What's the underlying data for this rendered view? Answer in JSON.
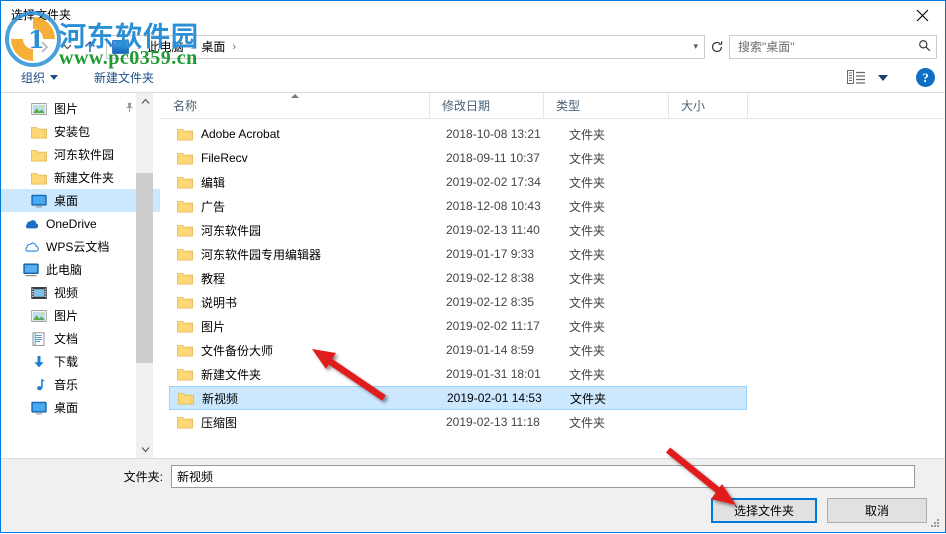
{
  "window": {
    "title": "选择文件夹",
    "close_label": "✕"
  },
  "nav": {
    "back_icon": "back-arrow-icon",
    "forward_icon": "forward-arrow-icon",
    "recent_icon": "chevron-down-icon",
    "up_icon": "up-arrow-icon",
    "refresh_icon": "refresh-icon",
    "breadcrumb": [
      "此电脑",
      "桌面"
    ],
    "separator": "›"
  },
  "search": {
    "placeholder": "搜索\"桌面\"",
    "icon": "search-icon"
  },
  "toolbar": {
    "organize_label": "组织",
    "new_folder_label": "新建文件夹",
    "view_icon": "view-layout-icon",
    "help_label": "?"
  },
  "sidebar": {
    "items": [
      {
        "label": "图片",
        "icon": "pictures-icon",
        "indent": 2,
        "pinned": true,
        "selected": false
      },
      {
        "label": "安装包",
        "icon": "folder-icon",
        "indent": 2,
        "pinned": false,
        "selected": false
      },
      {
        "label": "河东软件园",
        "icon": "folder-icon",
        "indent": 2,
        "pinned": false,
        "selected": false
      },
      {
        "label": "新建文件夹",
        "icon": "folder-icon",
        "indent": 2,
        "pinned": false,
        "selected": false
      },
      {
        "label": "桌面",
        "icon": "desktop-icon",
        "indent": 2,
        "pinned": false,
        "selected": true
      },
      {
        "label": "OneDrive",
        "icon": "onedrive-icon",
        "indent": 1,
        "pinned": false,
        "selected": false
      },
      {
        "label": "WPS云文档",
        "icon": "wps-cloud-icon",
        "indent": 1,
        "pinned": false,
        "selected": false
      },
      {
        "label": "此电脑",
        "icon": "this-pc-icon",
        "indent": 1,
        "pinned": false,
        "selected": false
      },
      {
        "label": "视频",
        "icon": "videos-icon",
        "indent": 2,
        "pinned": false,
        "selected": false
      },
      {
        "label": "图片",
        "icon": "pictures-icon",
        "indent": 2,
        "pinned": false,
        "selected": false
      },
      {
        "label": "文档",
        "icon": "documents-icon",
        "indent": 2,
        "pinned": false,
        "selected": false
      },
      {
        "label": "下载",
        "icon": "downloads-icon",
        "indent": 2,
        "pinned": false,
        "selected": false
      },
      {
        "label": "音乐",
        "icon": "music-icon",
        "indent": 2,
        "pinned": false,
        "selected": false
      },
      {
        "label": "桌面",
        "icon": "desktop-icon",
        "indent": 2,
        "pinned": false,
        "selected": false
      }
    ],
    "scroll_up_icon": "chevron-up-icon",
    "scroll_down_icon": "chevron-down-icon"
  },
  "filelist": {
    "columns": [
      "名称",
      "修改日期",
      "类型",
      "大小"
    ],
    "sort_column": "名称",
    "sort_direction": "asc",
    "rows": [
      {
        "name": "Adobe Acrobat",
        "date": "2018-10-08 13:21",
        "type": "文件夹",
        "size": "",
        "selected": false
      },
      {
        "name": "FileRecv",
        "date": "2018-09-11 10:37",
        "type": "文件夹",
        "size": "",
        "selected": false
      },
      {
        "name": "编辑",
        "date": "2019-02-02 17:34",
        "type": "文件夹",
        "size": "",
        "selected": false
      },
      {
        "name": "广告",
        "date": "2018-12-08 10:43",
        "type": "文件夹",
        "size": "",
        "selected": false
      },
      {
        "name": "河东软件园",
        "date": "2019-02-13 11:40",
        "type": "文件夹",
        "size": "",
        "selected": false
      },
      {
        "name": "河东软件园专用编辑器",
        "date": "2019-01-17 9:33",
        "type": "文件夹",
        "size": "",
        "selected": false
      },
      {
        "name": "教程",
        "date": "2019-02-12 8:38",
        "type": "文件夹",
        "size": "",
        "selected": false
      },
      {
        "name": "说明书",
        "date": "2019-02-12 8:35",
        "type": "文件夹",
        "size": "",
        "selected": false
      },
      {
        "name": "图片",
        "date": "2019-02-02 11:17",
        "type": "文件夹",
        "size": "",
        "selected": false
      },
      {
        "name": "文件备份大师",
        "date": "2019-01-14 8:59",
        "type": "文件夹",
        "size": "",
        "selected": false
      },
      {
        "name": "新建文件夹",
        "date": "2019-01-31 18:01",
        "type": "文件夹",
        "size": "",
        "selected": false
      },
      {
        "name": "新视频",
        "date": "2019-02-01 14:53",
        "type": "文件夹",
        "size": "",
        "selected": true
      },
      {
        "name": "压缩图",
        "date": "2019-02-13 11:18",
        "type": "文件夹",
        "size": "",
        "selected": false
      }
    ]
  },
  "footer": {
    "folder_label": "文件夹:",
    "folder_value": "新视频",
    "select_button": "选择文件夹",
    "cancel_button": "取消"
  },
  "watermark": {
    "brand": "河东软件园",
    "url": "www.pc0359.cn",
    "brand_color": "#2a8fd4",
    "url_color": "#1f9a33"
  },
  "annotations": {
    "arrow_color": "#e01b1b",
    "arrow_count": 2
  }
}
